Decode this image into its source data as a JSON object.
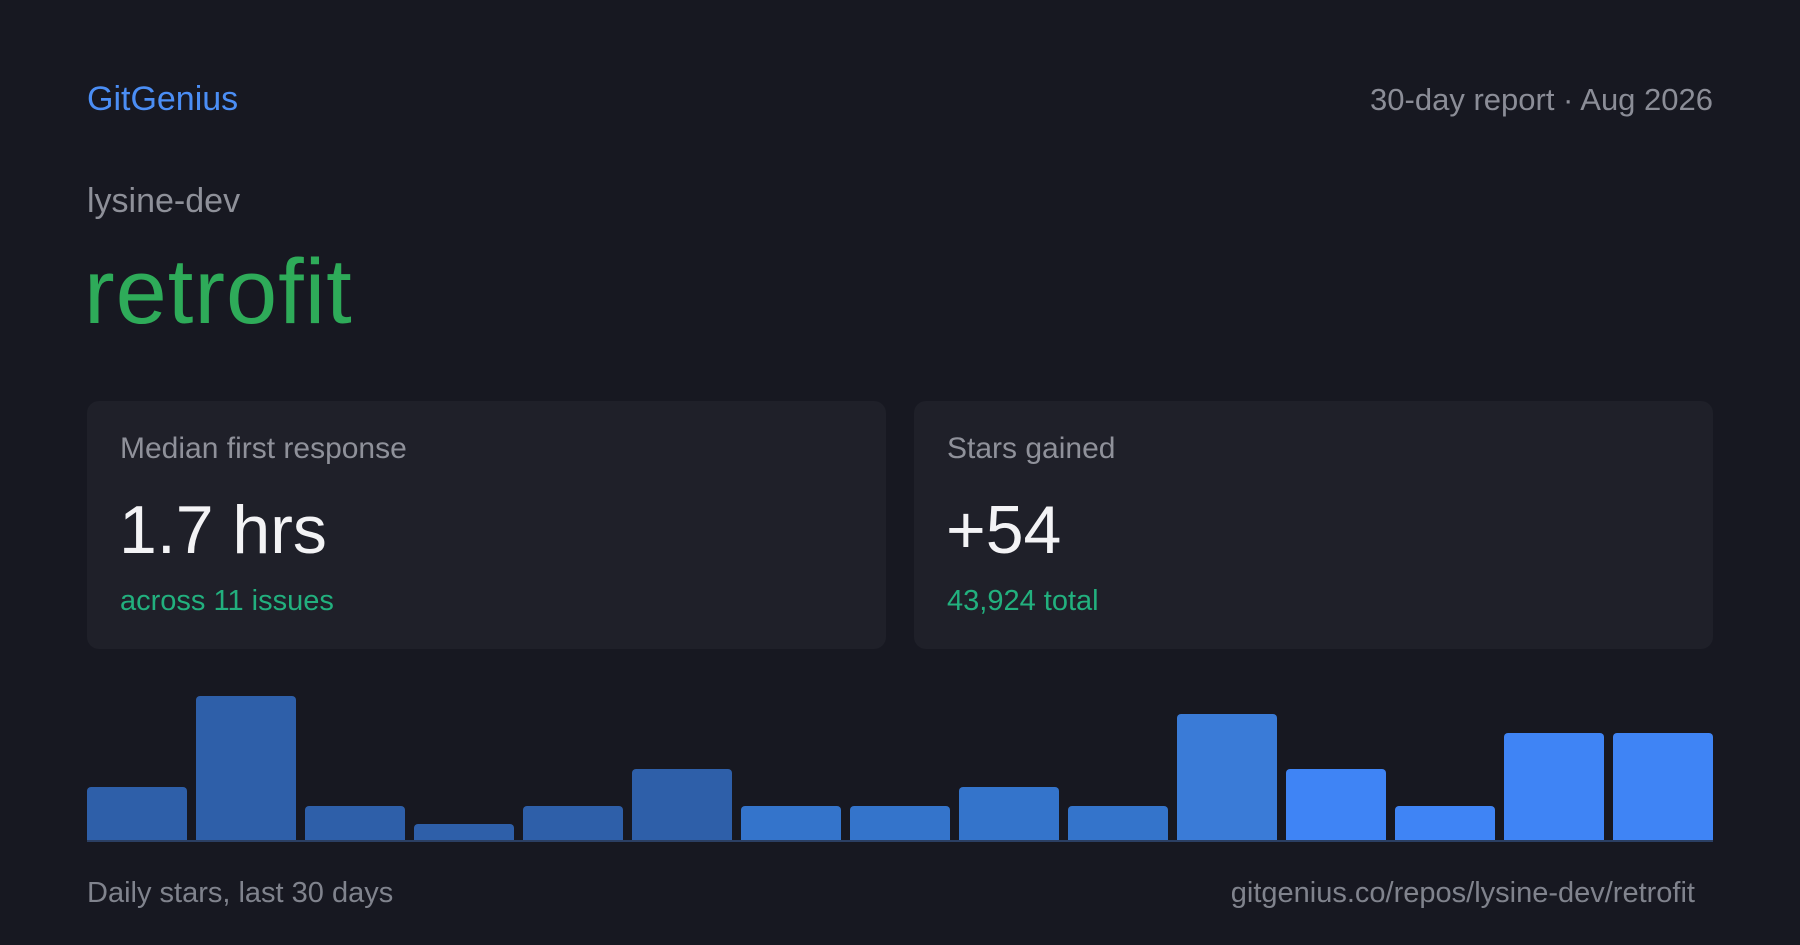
{
  "header": {
    "brand": "GitGenius",
    "report_label": "30-day report · Aug 2026"
  },
  "repo": {
    "owner": "lysine-dev",
    "name": "retrofit"
  },
  "cards": [
    {
      "label": "Median first response",
      "value": "1.7 hrs",
      "sub": "across 11 issues"
    },
    {
      "label": "Stars gained",
      "value": "+54",
      "sub": "43,924 total"
    }
  ],
  "chart_data": {
    "type": "bar",
    "values": [
      3,
      8,
      2,
      1,
      2,
      4,
      2,
      2,
      3,
      2,
      7,
      4,
      2,
      6,
      6
    ],
    "colors": [
      "#2e5fa9",
      "#2e5fa9",
      "#2e5fa9",
      "#2e5fa9",
      "#2e5fa9",
      "#2e5fa9",
      "#3474cb",
      "#3474cb",
      "#3474cb",
      "#3474cb",
      "#3a7bd7",
      "#3f84f5",
      "#3f84f5",
      "#3f84f5",
      "#3f84f5"
    ]
  },
  "footer": {
    "caption": "Daily stars, last 30 days",
    "url": "gitgenius.co/repos/lysine-dev/retrofit"
  },
  "colors": {
    "background": "#171821",
    "card": "#1f2029",
    "brand": "#4b8ef5",
    "repo": "#2eab59",
    "accent_sub": "#22b07e"
  }
}
